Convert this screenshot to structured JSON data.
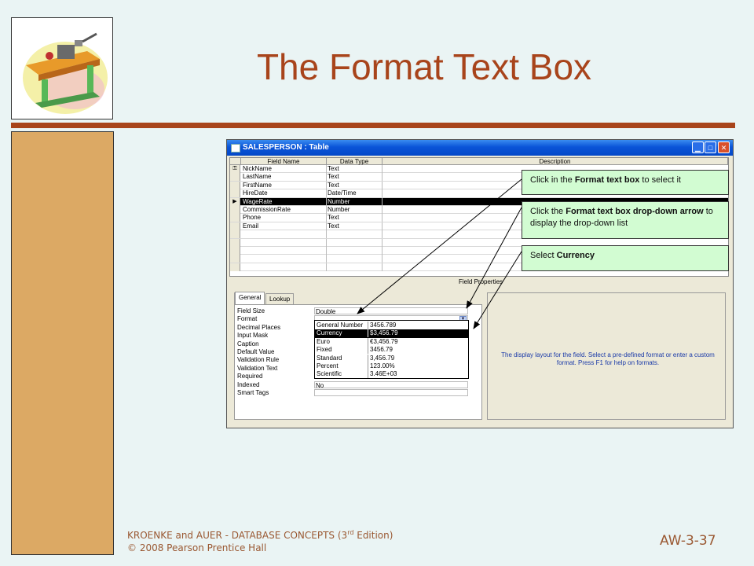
{
  "slide": {
    "title": "The Format Text Box",
    "footer_line1_pre": "KROENKE and AUER - DATABASE CONCEPTS (3",
    "footer_sup": "rd",
    "footer_line1_post": " Edition)",
    "footer_line2": "© 2008 Pearson Prentice Hall",
    "page_number": "AW-3-37",
    "accent_color": "#a8441b",
    "sidebar_color": "#dca964",
    "background_color": "#eaf4f4"
  },
  "window": {
    "title": "SALESPERSON : Table",
    "columns": [
      "Field Name",
      "Data Type",
      "Description"
    ],
    "rows": [
      {
        "field": "NickName",
        "type": "Text",
        "marker": "key"
      },
      {
        "field": "LastName",
        "type": "Text",
        "marker": ""
      },
      {
        "field": "FirstName",
        "type": "Text",
        "marker": ""
      },
      {
        "field": "HireDate",
        "type": "Date/Time",
        "marker": ""
      },
      {
        "field": "WageRate",
        "type": "Number",
        "marker": "current"
      },
      {
        "field": "CommissionRate",
        "type": "Number",
        "marker": ""
      },
      {
        "field": "Phone",
        "type": "Text",
        "marker": ""
      },
      {
        "field": "Email",
        "type": "Text",
        "marker": ""
      }
    ],
    "field_properties_label": "Field Properties",
    "tabs": [
      "General",
      "Lookup"
    ],
    "properties": [
      {
        "label": "Field Size",
        "value": "Double"
      },
      {
        "label": "Format",
        "value": ""
      },
      {
        "label": "Decimal Places",
        "value": ""
      },
      {
        "label": "Input Mask",
        "value": ""
      },
      {
        "label": "Caption",
        "value": ""
      },
      {
        "label": "Default Value",
        "value": ""
      },
      {
        "label": "Validation Rule",
        "value": ""
      },
      {
        "label": "Validation Text",
        "value": ""
      },
      {
        "label": "Required",
        "value": ""
      },
      {
        "label": "Indexed",
        "value": "No"
      },
      {
        "label": "Smart Tags",
        "value": ""
      }
    ],
    "format_options": [
      {
        "name": "General Number",
        "example": "3456.789"
      },
      {
        "name": "Currency",
        "example": "$3,456.79"
      },
      {
        "name": "Euro",
        "example": "€3,456.79"
      },
      {
        "name": "Fixed",
        "example": "3456.79"
      },
      {
        "name": "Standard",
        "example": "3,456.79"
      },
      {
        "name": "Percent",
        "example": "123.00%"
      },
      {
        "name": "Scientific",
        "example": "3.46E+03"
      }
    ],
    "highlighted_option": 1,
    "description_help": "The display layout for the field.  Select a pre-defined format or enter a custom format.  Press F1 for help on formats."
  },
  "callouts": [
    {
      "pre": "Click in the ",
      "bold": "Format text box",
      "post": " to select it"
    },
    {
      "pre": "Click the ",
      "bold": "Format text box drop-down arrow",
      "post": " to display the drop-down list"
    },
    {
      "pre": "Select ",
      "bold": "Currency",
      "post": ""
    }
  ]
}
